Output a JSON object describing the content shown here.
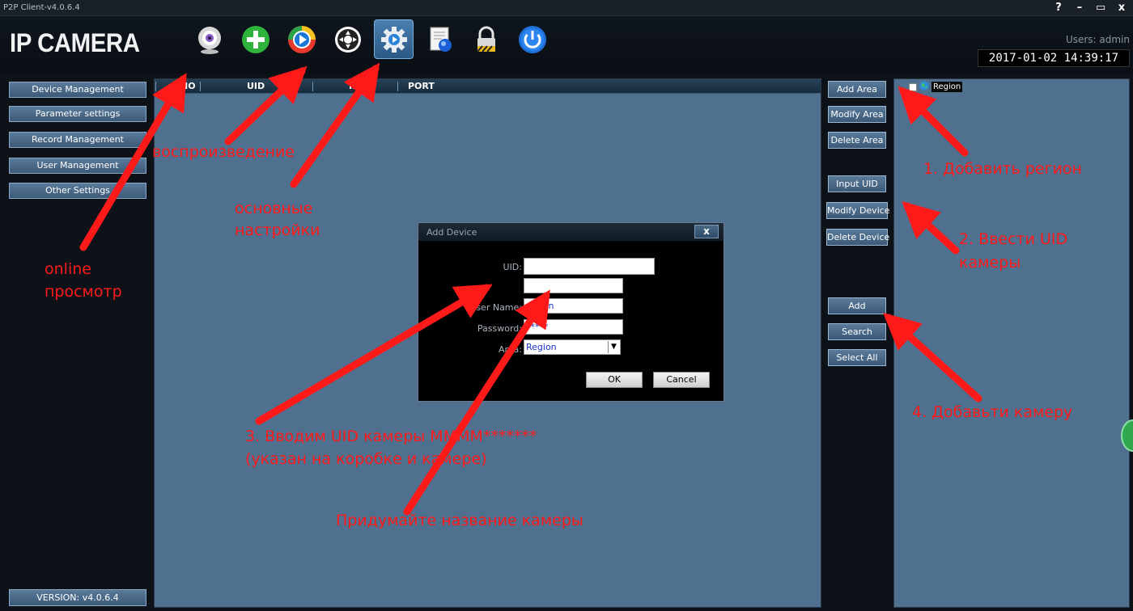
{
  "window": {
    "title": "P2P Client-v4.0.6.4",
    "buttons": [
      "?",
      "–",
      "▭",
      "x"
    ]
  },
  "header": {
    "logo": "IP CAMERA",
    "users": "Users: admin",
    "datetime": "2017-01-02 14:39:17",
    "toolbar_icons": [
      "webcam-icon",
      "plus-icon",
      "play-icon",
      "ptz-icon",
      "settings-icon",
      "log-icon",
      "lock-icon",
      "power-icon"
    ]
  },
  "sidebar": {
    "items": [
      {
        "label": "Device Management"
      },
      {
        "label": "Parameter settings"
      },
      {
        "label": "Record Management"
      },
      {
        "label": "User Management"
      },
      {
        "label": "Other Settings"
      }
    ],
    "version": "VERSION: v4.0.6.4"
  },
  "table": {
    "columns": [
      "NO",
      "UID",
      "IP",
      "PORT"
    ]
  },
  "actions": {
    "add_area": "Add Area",
    "modify_area": "Modify Area",
    "delete_area": "Delete Area",
    "input_uid": "Input UID",
    "modify_device": "Modify Device",
    "delete_device": "Delete Device",
    "add": "Add",
    "search": "Search",
    "select_all": "Select All"
  },
  "tree": {
    "root": "Region"
  },
  "dialog": {
    "title": "Add Device",
    "close": "x",
    "fields": {
      "uid_label": "UID:",
      "uid_value": "",
      "name_label": "",
      "name_value": "",
      "username_label": "User Name:",
      "username_value": "admin",
      "password_label": "Password:",
      "password_value": "*****",
      "area_label": "Area:",
      "area_value": "Region"
    },
    "ok": "OK",
    "cancel": "Cancel"
  },
  "annotations": {
    "playback": "воспроизведение",
    "main_settings_1": "основные",
    "main_settings_2": "настройки",
    "online_1": "online",
    "online_2": "просмотр",
    "step1": "1. Добавить регион",
    "step2_1": "2. Ввести UID",
    "step2_2": "камеры",
    "step3_1": "3. Вводим UID камеры MMMM*******",
    "step3_2": "(указан на коробке и камере)",
    "step_name": "Придумайте название камеры",
    "step4": "4. Добавьти камеру"
  },
  "colors": {
    "panel": "#50708f",
    "annotation": "#ff1a1a",
    "button": "#4a6a8a"
  }
}
